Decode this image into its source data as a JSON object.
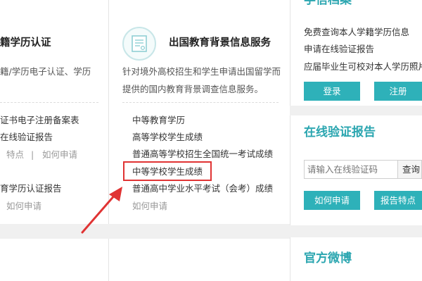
{
  "left_column": {
    "title": "籍学历认证",
    "desc": "籍/学历电子认证、学历",
    "item_1": "证书电子注册备案表",
    "item_2": "在线验证报告",
    "item_2_links": {
      "features": "特点",
      "sep": "|",
      "howto": "如何申请"
    },
    "item_3": "育学历认证报告",
    "item_3_link": "如何申请"
  },
  "middle_column": {
    "icon": "certificate-icon",
    "title": "出国教育背景信息服务",
    "desc_line1": "针对境外高校招生和学生申请出国留学而",
    "desc_line2": "提供的国内教育背景调查信息服务。",
    "items": [
      "中等教育学历",
      "高等学校学生成绩",
      "普通高等学校招生全国统一考试成绩",
      "中等学校学生成绩",
      "普通高中学业水平考试（会考）成绩"
    ],
    "last_link": "如何申请",
    "highlight_color": "#e03333"
  },
  "right_column": {
    "top_title": "学信档案",
    "top_items": [
      "免费查询本人学籍学历信息",
      "申请在线验证报告",
      "应届毕业生可校对本人学历照片"
    ],
    "login_label": "登录",
    "register_label": "注册",
    "verify_title": "在线验证报告",
    "verify_placeholder": "请输入在线验证码",
    "query_label": "查询",
    "howto_label": "如何申请",
    "features_label": "报告特点",
    "weibo_title": "官方微博",
    "accent_color": "#2eb1b9"
  }
}
